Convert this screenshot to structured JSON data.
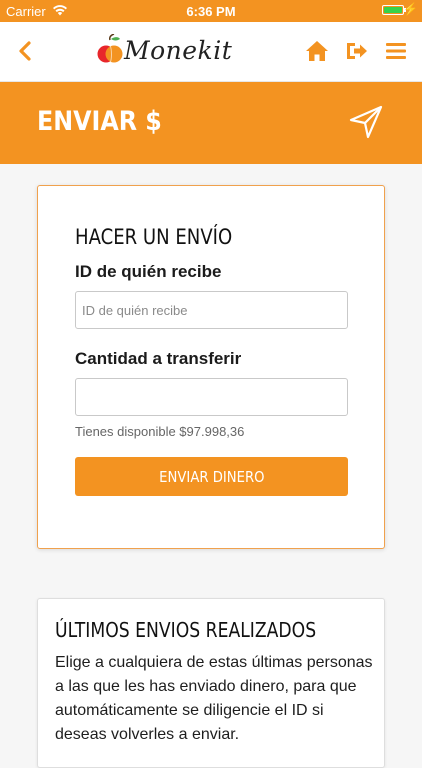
{
  "status_bar": {
    "carrier": "Carrier",
    "time": "6:36 PM",
    "battery_level": 1.0
  },
  "nav": {
    "logo_text": "Monekit",
    "icons": [
      "back-chevron-icon",
      "home-icon",
      "logout-icon",
      "hamburger-menu-icon"
    ]
  },
  "header": {
    "title": "ENVIAR $",
    "icon": "send-arrow-icon"
  },
  "send_form": {
    "title": "HACER UN ENVÍO",
    "recipient_label": "ID de quién recibe",
    "recipient_placeholder": "ID de quién recibe",
    "recipient_value": "",
    "amount_label": "Cantidad a transferir",
    "amount_placeholder": "",
    "amount_value": "",
    "available_text": "Tienes disponible $97.998,36",
    "submit_label": "ENVIAR DINERO"
  },
  "recent": {
    "title": "ÚLTIMOS ENVIOS REALIZADOS",
    "description": "Elige a cualquiera de estas últimas personas a las que les has enviado dinero, para que automáticamente se diligencie el ID si deseas volverles a enviar."
  },
  "colors": {
    "accent": "#f39321",
    "card_border": "#f0a14d",
    "battery": "#37d24a"
  }
}
